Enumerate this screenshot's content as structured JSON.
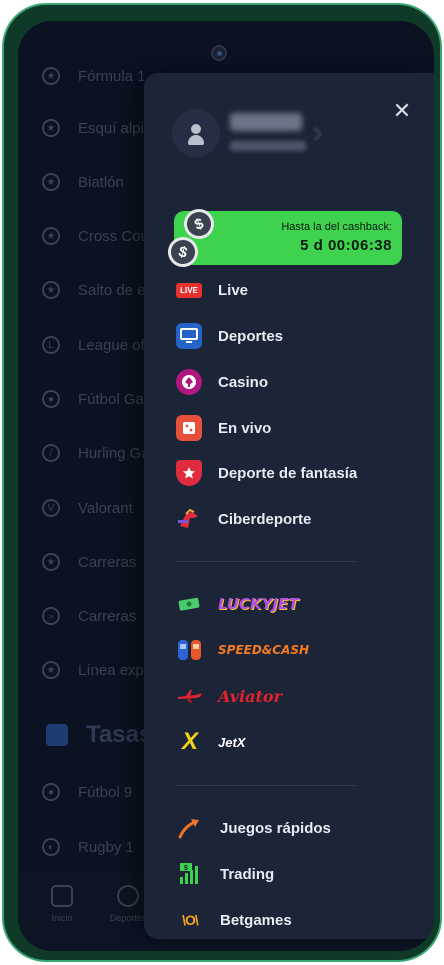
{
  "background": {
    "list": [
      {
        "label": "Fórmula 1",
        "icon": "star-icon"
      },
      {
        "label": "Esquí alpino",
        "icon": "star-icon"
      },
      {
        "label": "Biatlón",
        "icon": "star-icon"
      },
      {
        "label": "Cross Country",
        "icon": "star-icon"
      },
      {
        "label": "Salto de esquí",
        "icon": "star-icon"
      },
      {
        "label": "League of Legends",
        "icon": "lol-icon"
      },
      {
        "label": "Fútbol Gaélico",
        "icon": "ball-icon"
      },
      {
        "label": "Hurling Gaélico",
        "icon": "hurling-icon"
      },
      {
        "label": "Valorant",
        "icon": "valorant-icon"
      },
      {
        "label": "Carreras",
        "icon": "star-icon"
      },
      {
        "label": "Carreras",
        "icon": "racing-icon"
      },
      {
        "label": "Línea exprés",
        "icon": "star-icon"
      }
    ],
    "section_title": "Tasas",
    "section_items": [
      {
        "label": "Fútbol 9",
        "icon": "football-icon"
      },
      {
        "label": "Rugby 1",
        "icon": "rugby-icon"
      }
    ],
    "bottom_nav": [
      {
        "label": "Inicio",
        "icon": "home-icon"
      },
      {
        "label": "Deportes",
        "icon": "sports-ball-icon"
      }
    ]
  },
  "drawer": {
    "close_symbol": "✕",
    "cashback": {
      "label": "Hasta la del cashback:",
      "timer": "5 d 00:06:38",
      "coin_symbol": "$",
      "color": "#3ed24f"
    },
    "menu": [
      {
        "label": "Live",
        "badge": "LIVE",
        "icon": "live-icon"
      },
      {
        "label": "Deportes",
        "icon": "monitor-icon"
      },
      {
        "label": "Casino",
        "icon": "casino-chip-icon"
      },
      {
        "label": "En vivo",
        "icon": "dice-icon"
      },
      {
        "label": "Deporte de fantasía",
        "icon": "fantasy-star-icon"
      },
      {
        "label": "Ciberdeporte",
        "icon": "cyber-soldier-icon"
      }
    ],
    "games": [
      {
        "logo": "LUCKYJET",
        "icon": "money-icon"
      },
      {
        "logo": "SPEED&CASH",
        "icon": "cars-icon"
      },
      {
        "logo": "Aviator",
        "icon": "plane-icon"
      },
      {
        "logo": "JetX",
        "icon": "jetx-icon",
        "icon_glyph": "X"
      }
    ],
    "extra": [
      {
        "label": "Juegos rápidos",
        "icon": "fast-arrow-icon"
      },
      {
        "label": "Trading",
        "icon": "trading-chart-icon"
      },
      {
        "label": "Betgames",
        "icon": "betgames-icon",
        "icon_glyph": "\\O\\"
      }
    ]
  }
}
